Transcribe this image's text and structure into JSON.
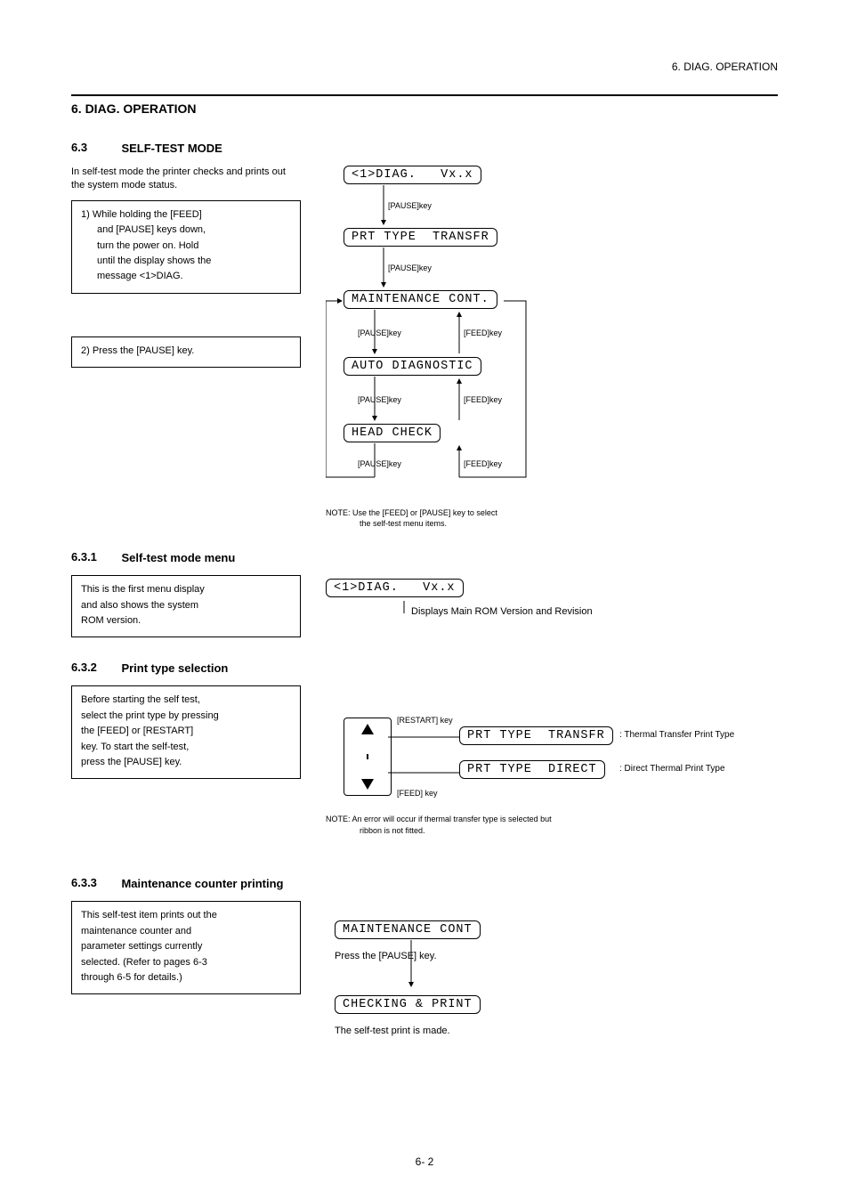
{
  "header": {
    "right": "6. DIAG. OPERATION",
    "left": "6.  DIAG. OPERATION",
    "sub_num": "6.3",
    "sub_title": "SELF-TEST MODE"
  },
  "flowchart": {
    "intro": "In self-test mode the printer checks and prints out the system mode status.",
    "box1": {
      "l1": "1)  While  holding  the  [FEED]",
      "l2": "and  [PAUSE]  keys  down,",
      "l3": "turn  the  power  on.    Hold",
      "l4": "until the display shows the",
      "l5": "message  <1>DIAG."
    },
    "box2": {
      "l1": "2)  Press the [PAUSE] key."
    },
    "nodes": {
      "n1": "<1>DIAG.   Vx.x",
      "n2": "PRT TYPE  TRANSFR",
      "n3": "MAINTENANCE CONT.",
      "n4": "AUTO DIAGNOSTIC",
      "n5": "HEAD CHECK"
    },
    "keylabels": {
      "pause_a": "[PAUSE]key",
      "pause_b": "[PAUSE]key",
      "pause_c": "[PAUSE]key",
      "pause_d": "[PAUSE]key",
      "pause_e": "[PAUSE]key",
      "feed_a": "[FEED]key",
      "feed_b": "[FEED]key",
      "feed_c": "[FEED]key"
    },
    "note_line1": "NOTE:  Use  the  [FEED]  or  [PAUSE]  key  to  select",
    "note_line2": "the self-test menu items."
  },
  "section1": {
    "num": "6.3.1",
    "title": "Self-test mode menu",
    "box": {
      "l1": "This  is  the  first  menu  display",
      "l2": "and  also  shows  the  system",
      "l3": "ROM version."
    },
    "lcd": "<1>DIAG.   Vx.x",
    "caption": "Displays Main ROM Version and Revision"
  },
  "section2": {
    "num": "6.3.2",
    "title": "Print type selection",
    "box": {
      "l1": "Before  starting  the  self  test,",
      "l2": "select the print type by pressing",
      "l3": "the  [FEED]  or  [RESTART]",
      "l4": "key.    To  start  the  self-test,",
      "l5": "press the [PAUSE] key."
    },
    "key_label_up": "[RESTART] key",
    "key_label_down": "[FEED] key",
    "opt1": "PRT TYPE  TRANSFR",
    "opt1_cap": ": Thermal Transfer Print Type",
    "opt2": "PRT TYPE  DIRECT",
    "opt2_cap": ": Direct Thermal Print Type",
    "note_line1": "NOTE: An  error  will  occur  if  thermal  transfer  type  is  selected  but ",
    "note_line2": "ribbon is not fitted."
  },
  "section3": {
    "num": "6.3.3",
    "title": "Maintenance counter printing",
    "box": {
      "l1": "This self-test item prints out the",
      "l2": "maintenance counter and",
      "l3": "parameter  settings  currently",
      "l4": "selected.    (Refer  to  pages  6-3",
      "l5": "through 6-5 for details.)"
    },
    "lcd1": "MAINTENANCE CONT",
    "lcd2": "CHECKING & PRINT",
    "cap1": "Press the [PAUSE] key.",
    "cap2": "The self-test print is made."
  },
  "footer": "6- 2"
}
